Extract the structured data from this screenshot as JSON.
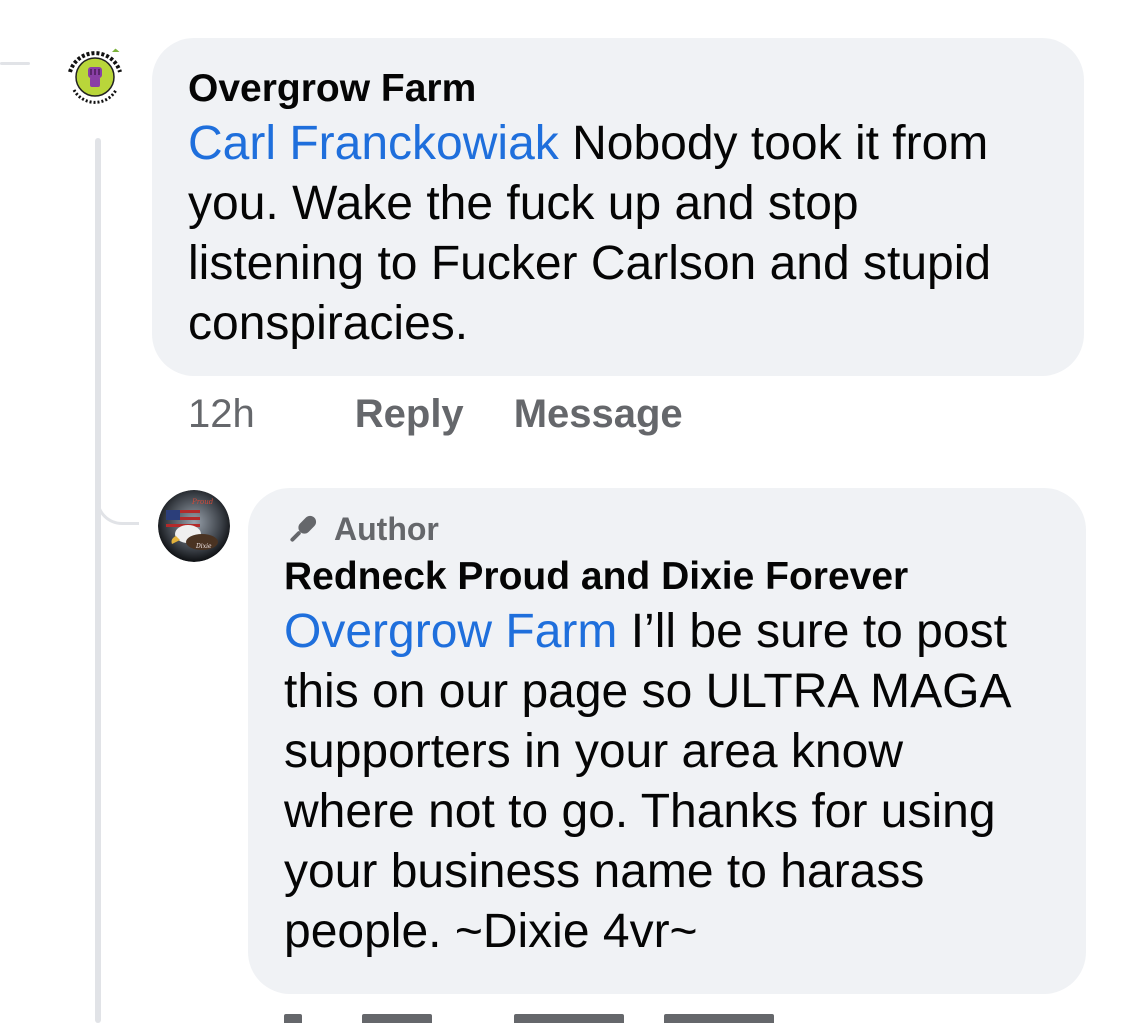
{
  "comment1": {
    "page_name": "Overgrow Farm",
    "mention": "Carl Franckowiak",
    "text_lines": [
      " Nobody took it from",
      "you. Wake the fuck up and stop",
      "listening to Fucker Carlson and stupid",
      "conspiracies."
    ],
    "time": "12h",
    "reply_label": "Reply",
    "message_label": "Message"
  },
  "comment2": {
    "badge_label": "Author",
    "page_name": "Redneck Proud and Dixie Forever",
    "mention": "Overgrow Farm",
    "text_lines": [
      " I’ll be sure to post",
      "this on our page so ULTRA MAGA",
      "supporters in your area know",
      "where not to go. Thanks for using",
      "your business name to harass",
      "people. ~Dixie 4vr~"
    ]
  },
  "colors": {
    "bubble": "#f0f2f5",
    "mention": "#1f6fdc",
    "muted": "#65676b",
    "thread": "#e1e3e7"
  }
}
